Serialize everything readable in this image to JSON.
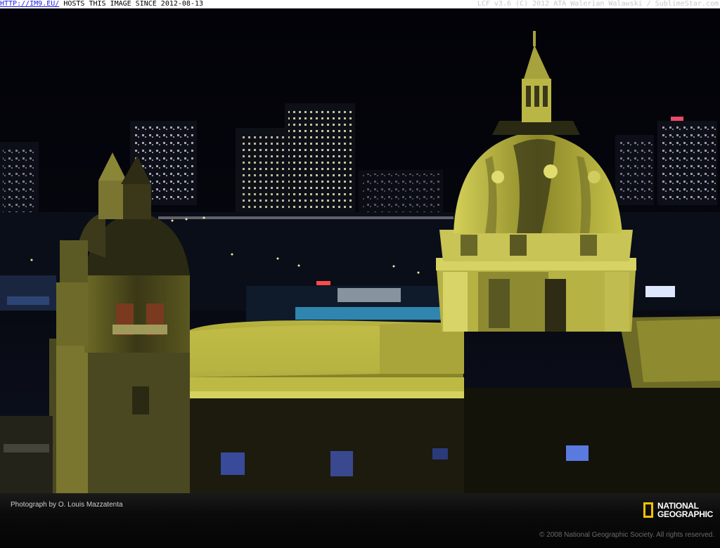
{
  "topbar": {
    "link": "HTTP://IM9.EU/",
    "hosting": "HOSTS THIS IMAGE SINCE 2012-08-13",
    "right": "LCF v3.6 (C) 2012 ATA Walerian Walawski / SublimeStar.com"
  },
  "footer": {
    "credit": "Photograph by O. Louis Mazzatenta",
    "copyright": "© 2008 National Geographic Society. All rights reserved.",
    "logo_line1": "NATIONAL",
    "logo_line2": "GEOGRAPHIC"
  },
  "colors": {
    "stone_lit": "#c9c44a",
    "stone_dark": "#4f4c1c",
    "sky": "#05050c",
    "logo_yellow": "#f2c200"
  }
}
